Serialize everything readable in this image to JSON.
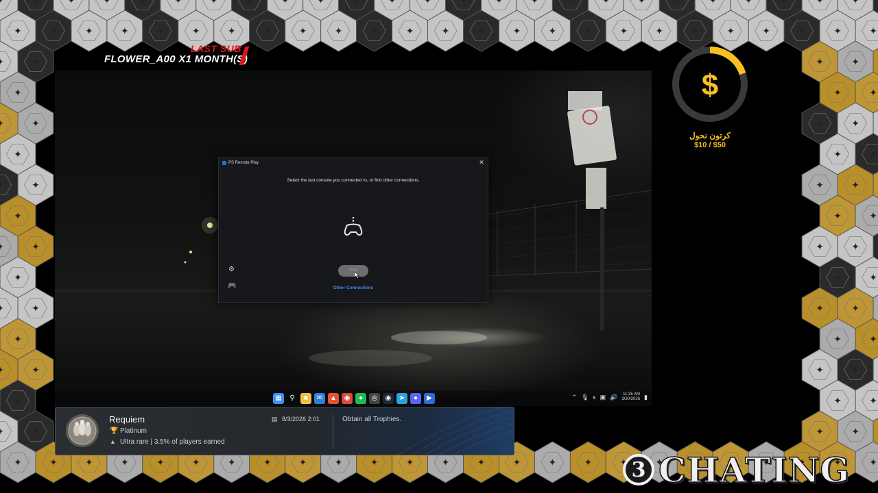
{
  "overlay": {
    "last_sub_label": "LAST SUB",
    "last_sub_name": "FLOWER_A00 X1 MONTH(S)",
    "goal": {
      "icon": "dollar-icon",
      "label": "كرتون نحول",
      "amount": "$10 / $50",
      "progress": 0.2,
      "color": "#f5c020"
    },
    "brand": {
      "badge": "3",
      "text": "CHATING"
    }
  },
  "dialog": {
    "title": "PS Remote Play",
    "message": "Select the last console you connected to, or find other connections.",
    "center_icon": "game-controller-icon",
    "start_button_label": "PS5",
    "other_connections_label": "Other Connections",
    "settings_icon": "gear-icon",
    "controller_icon": "controller-icon",
    "close_icon": "close-icon",
    "link_color": "#3b8cf0"
  },
  "taskbar": {
    "apps": [
      "start-icon",
      "search-icon",
      "file-explorer-icon",
      "mail-icon",
      "brave-icon",
      "chrome-icon",
      "spotify-icon",
      "obs-icon",
      "steam-icon",
      "telegram-icon",
      "discord-icon",
      "ps-remote-play-icon"
    ],
    "time": "11:35 AM",
    "date": "3/30/2026"
  },
  "trophy": {
    "game": "Requiem",
    "grade": "Platinum",
    "rarity": "Ultra rare | 3.5% of players earned",
    "date": "8/3/2026  2:01",
    "description": "Obtain all Trophies."
  }
}
